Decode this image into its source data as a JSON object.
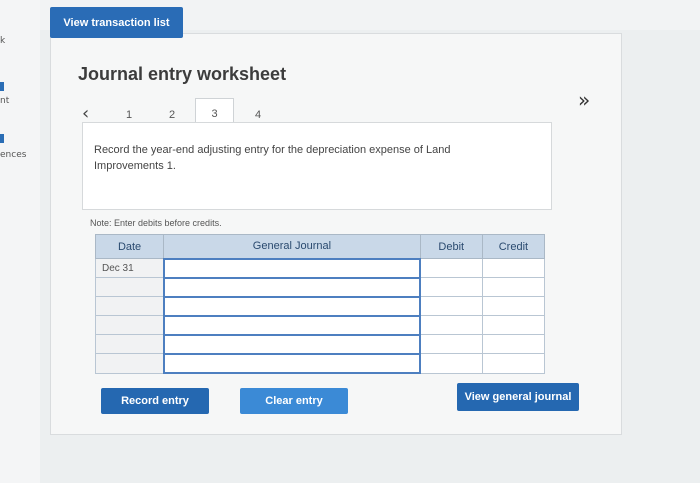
{
  "left_strip": {
    "glyphs": [
      "k",
      "nt",
      "ences"
    ]
  },
  "header": {
    "view_transaction_list": "View transaction list"
  },
  "worksheet": {
    "title": "Journal entry worksheet",
    "tabs": [
      "1",
      "2",
      "3",
      "4"
    ],
    "active_tab": "3",
    "prompt": "Record the year-end adjusting entry for the depreciation expense of Land Improvements 1.",
    "note": "Note: Enter debits before credits."
  },
  "journal_table": {
    "columns": [
      "Date",
      "General Journal",
      "Debit",
      "Credit"
    ],
    "rows": [
      [
        "Dec 31",
        "",
        "",
        ""
      ],
      [
        "",
        "",
        "",
        ""
      ],
      [
        "",
        "",
        "",
        ""
      ],
      [
        "",
        "",
        "",
        ""
      ],
      [
        "",
        "",
        "",
        ""
      ],
      [
        "",
        "",
        "",
        ""
      ]
    ]
  },
  "buttons": {
    "record_entry": "Record entry",
    "clear_entry": "Clear entry",
    "view_general_journal": "View general journal"
  },
  "icons": {
    "prev": "chevron-left-icon",
    "next": "double-chevron-right-icon"
  },
  "colors": {
    "primary_button": "#2568b1",
    "header_fill": "#c9d8e8"
  }
}
